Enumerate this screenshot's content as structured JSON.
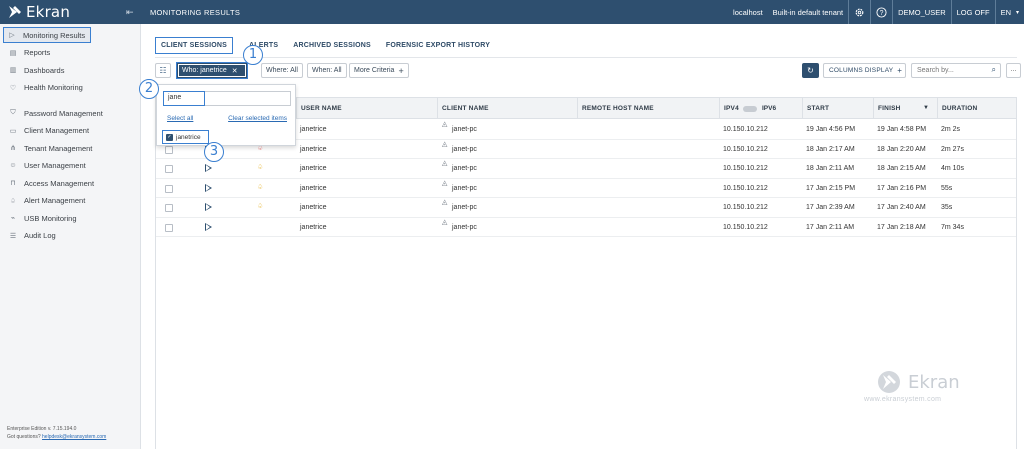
{
  "app": {
    "logo_text": "Ekran",
    "page_heading": "MONITORING RESULTS"
  },
  "topbar": {
    "host": "localhost",
    "tenant": "Built-in default tenant",
    "settings_icon": "gear-icon",
    "help_icon": "question-icon",
    "user": "DEMO_USER",
    "logoff": "LOG OFF",
    "language": "EN"
  },
  "sidebar": {
    "items": [
      {
        "label": "Monitoring Results",
        "icon": "play-icon"
      },
      {
        "label": "Reports",
        "icon": "report-icon"
      },
      {
        "label": "Dashboards",
        "icon": "chart-icon"
      },
      {
        "label": "Health Monitoring",
        "icon": "heart-icon"
      },
      {
        "label": "Password Management",
        "icon": "shield-icon"
      },
      {
        "label": "Client Management",
        "icon": "monitor-icon"
      },
      {
        "label": "Tenant Management",
        "icon": "hierarchy-icon"
      },
      {
        "label": "User Management",
        "icon": "user-icon"
      },
      {
        "label": "Access Management",
        "icon": "lock-icon"
      },
      {
        "label": "Alert Management",
        "icon": "bell-icon"
      },
      {
        "label": "USB Monitoring",
        "icon": "usb-icon"
      },
      {
        "label": "Audit Log",
        "icon": "list-icon"
      }
    ],
    "footer_edition": "Enterprise Edition v. 7.15.194.0",
    "footer_questions": "Got questions?",
    "footer_email": "helpdesk@ekransystem.com"
  },
  "tabs": [
    {
      "label": "CLIENT SESSIONS",
      "active": true
    },
    {
      "label": "ALERTS",
      "active": false
    },
    {
      "label": "ARCHIVED SESSIONS",
      "active": false
    },
    {
      "label": "FORENSIC EXPORT HISTORY",
      "active": false
    }
  ],
  "filters": {
    "who_chip": "Who: janetrice",
    "where_chip": "Where: All",
    "when_chip": "When: All",
    "more_criteria": "More Criteria",
    "columns_display": "COLUMNS DISPLAY",
    "search_placeholder": "Search by...",
    "more_button": "..."
  },
  "dropdown": {
    "search_value": "jane",
    "select_all": "Select all",
    "clear_selected": "Clear selected items",
    "option_label": "janetrice",
    "option_checked": true
  },
  "callouts": [
    "1",
    "2",
    "3"
  ],
  "table": {
    "headers": {
      "user_name": "USER NAME",
      "client_name": "CLIENT NAME",
      "remote_host": "REMOTE HOST NAME",
      "ipv4": "IPV4",
      "ipv6": "IPV6",
      "start": "START",
      "finish": "FINISH",
      "duration": "DURATION"
    },
    "rows": [
      {
        "user": "janetrice",
        "client": "janet-pc",
        "ip": "10.150.10.212",
        "start": "19 Jan 4:56 PM",
        "finish": "19 Jan 4:58 PM",
        "duration": "2m 2s",
        "bell": "none"
      },
      {
        "user": "janetrice",
        "client": "janet-pc",
        "ip": "10.150.10.212",
        "start": "18 Jan 2:17 AM",
        "finish": "18 Jan 2:20 AM",
        "duration": "2m 27s",
        "bell": "red"
      },
      {
        "user": "janetrice",
        "client": "janet-pc",
        "ip": "10.150.10.212",
        "start": "18 Jan 2:11 AM",
        "finish": "18 Jan 2:15 AM",
        "duration": "4m 10s",
        "bell": "yellow"
      },
      {
        "user": "janetrice",
        "client": "janet-pc",
        "ip": "10.150.10.212",
        "start": "17 Jan 2:15 PM",
        "finish": "17 Jan 2:16 PM",
        "duration": "55s",
        "bell": "yellow"
      },
      {
        "user": "janetrice",
        "client": "janet-pc",
        "ip": "10.150.10.212",
        "start": "17 Jan 2:39 AM",
        "finish": "17 Jan 2:40 AM",
        "duration": "35s",
        "bell": "yellow"
      },
      {
        "user": "janetrice",
        "client": "janet-pc",
        "ip": "10.150.10.212",
        "start": "17 Jan 2:11 AM",
        "finish": "17 Jan 2:18 AM",
        "duration": "7m 34s",
        "bell": "none"
      }
    ]
  },
  "watermark": {
    "brand": "Ekran",
    "url": "www.ekransystem.com"
  },
  "colors": {
    "topbar": "#2e4f6f",
    "highlight": "#3a7fd0",
    "link": "#2a6ab3",
    "alert_yellow": "#e0a400",
    "alert_red": "#e04040"
  }
}
